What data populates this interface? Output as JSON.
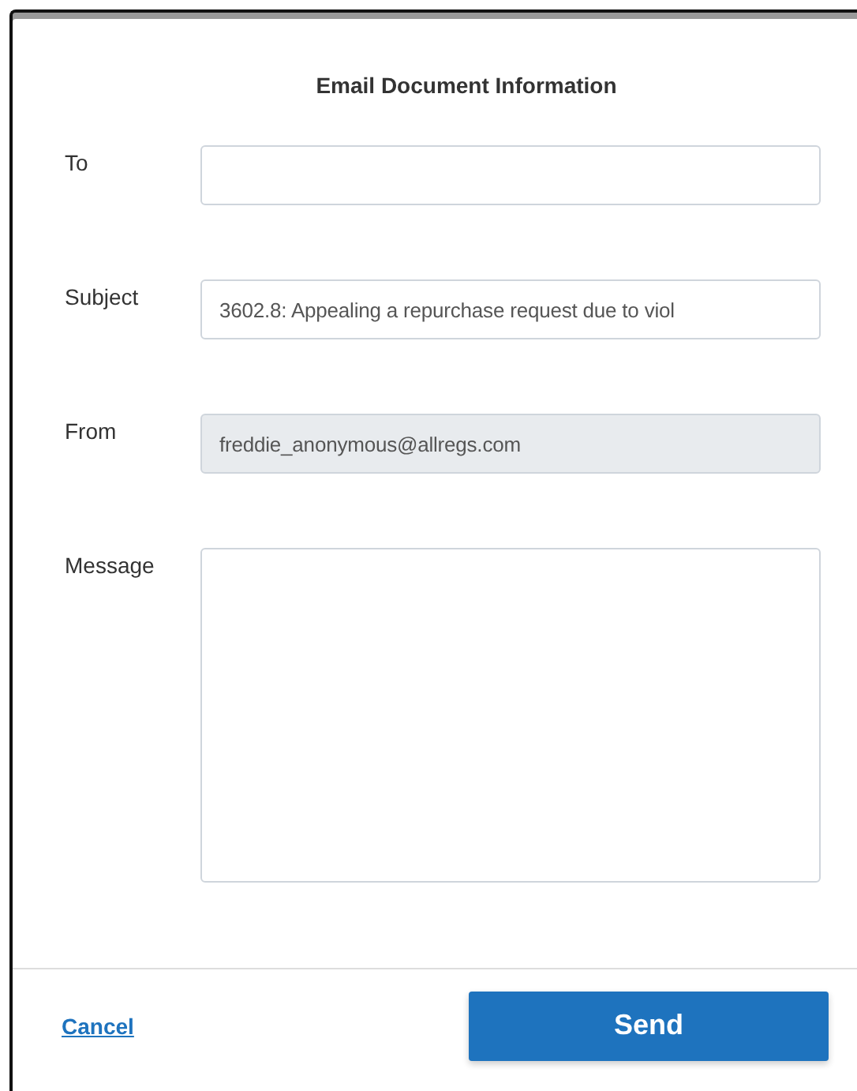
{
  "dialog": {
    "title": "Email Document Information",
    "fields": [
      {
        "label": "To",
        "kind": "input",
        "disabled": false
      },
      {
        "label": "Subject",
        "kind": "input",
        "value": "3602.8: Appealing a repurchase request due to viol",
        "disabled": false
      },
      {
        "label": "From",
        "kind": "input",
        "value": "freddie_anonymous@allregs.com",
        "disabled": true
      },
      {
        "label": "Message",
        "kind": "textarea",
        "disabled": false
      }
    ],
    "cancel": "Cancel",
    "send": "Send"
  }
}
